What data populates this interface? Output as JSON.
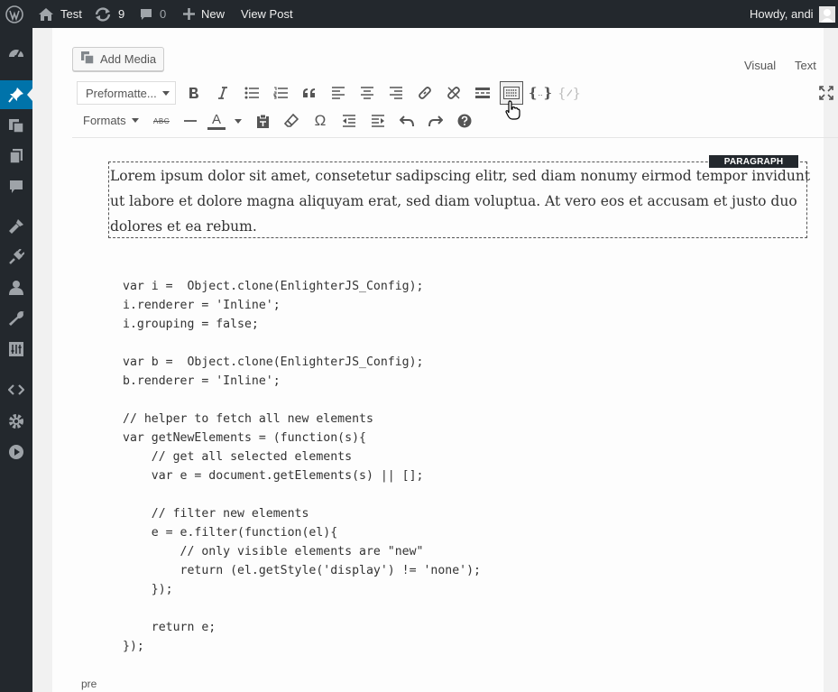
{
  "adminbar": {
    "site_name": "Test",
    "updates_count": "9",
    "comments_count": "0",
    "new_label": "New",
    "view_post_label": "View Post",
    "greeting": "Howdy, andi"
  },
  "sidebar": {
    "items": [
      {
        "icon": "dashboard-icon"
      },
      {
        "icon": "pin-icon",
        "current": true
      },
      {
        "icon": "media-icon"
      },
      {
        "icon": "pages-icon"
      },
      {
        "icon": "comments-icon"
      },
      {
        "icon": "appearance-icon"
      },
      {
        "icon": "plugins-icon"
      },
      {
        "icon": "users-icon"
      },
      {
        "icon": "tools-icon"
      },
      {
        "icon": "settings-sliders-icon"
      },
      {
        "icon": "code-icon"
      },
      {
        "icon": "gear-icon"
      },
      {
        "icon": "play-icon"
      }
    ]
  },
  "editor": {
    "add_media_label": "Add Media",
    "visual_tab": "Visual",
    "text_tab": "Text",
    "format_select_value": "Preformatte...",
    "formats_menu_label": "Formats",
    "strikethrough_label": "ABC",
    "text_color_label": "A",
    "paragraph_badge": "PARAGRAPH",
    "paragraph_text": "Lorem ipsum dolor sit amet, consetetur sadipscing elitr, sed diam nonumy eirmod tempor invidunt ut labore et dolore magna aliquyam erat, sed diam voluptua. At vero eos et accusam et justo duo dolores et ea rebum.",
    "code_text": "var i =  Object.clone(EnlighterJS_Config);\ni.renderer = 'Inline';\ni.grouping = false;\n\nvar b =  Object.clone(EnlighterJS_Config);\nb.renderer = 'Inline';\n\n// helper to fetch all new elements\nvar getNewElements = (function(s){\n    // get all selected elements\n    var e = document.getElements(s) || [];\n\n    // filter new elements\n    e = e.filter(function(el){\n        // only visible elements are \"new\"\n        return (el.getStyle('display') != 'none');\n    });\n\n    return e;\n});",
    "status_path": "pre"
  },
  "colors": {
    "adminbar_bg": "#23282d",
    "accent": "#0073aa",
    "text": "#555555"
  }
}
